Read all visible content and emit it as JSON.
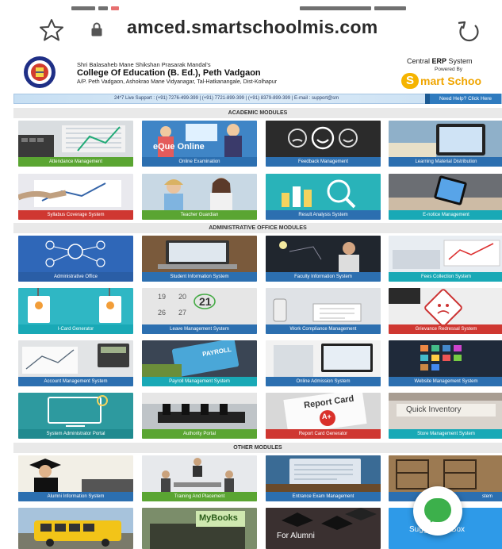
{
  "browser": {
    "url": "amced.smartschoolmis.com"
  },
  "header": {
    "trust": "Shri Balasaheb Mane Shikshan Prasarak Mandal's",
    "college": "College Of Education (B. Ed.), Peth Vadgaon",
    "address": "A/P. Peth Vadgaon, Ashokrao Mane Vidyanagar, Tal-Hatkanangale, Dist-Kolhapur",
    "erp_prefix": "Central ",
    "erp_bold": "ERP",
    "erp_suffix": " System",
    "powered_by": "Powered By",
    "brand_initial": "S",
    "brand_text": "mart Schoo"
  },
  "support": {
    "text": "24*7 Live Support : (+91) 7276-499-399 | (+91) 7721-899-399 | (+91) 8379-899-399 | E-mail : support@sm",
    "help_label": "Need Help? Click Here"
  },
  "sections": {
    "academic": "ACADEMIC MODULES",
    "administrative": "ADMINISTRATIVE OFFICE MODULES",
    "other": "OTHER MODULES"
  },
  "tiles": {
    "attendance": "Attendance Management",
    "online_exam": "Online Examination",
    "online_exam_art": "eQue Online",
    "feedback": "Feedback Management",
    "learning": "Learning Material Distribution",
    "syllabus": "Syllabus Coverage System",
    "teacher_guardian": "Teacher Guardian",
    "result": "Result Analysis System",
    "enotice": "E-notice Management",
    "admin_office": "Administrative Office",
    "student_info": "Student Information System",
    "faculty_info": "Faculty Information System",
    "fees": "Fees Collection System",
    "icard": "I-Card Generator",
    "leave": "Leave Management System",
    "work_compliance": "Work Compliance Management",
    "grievance": "Grievance Redressal System",
    "account": "Account Management System",
    "payroll": "Payroll Management System",
    "payroll_art": "PAYROLL",
    "online_admission": "Online Admission System",
    "website": "Website Management System",
    "sysadmin": "System Administrator Portal",
    "authority": "Authority Portal",
    "report_card": "Report Card Generator",
    "report_card_art": "Report Card",
    "report_card_grade": "A+",
    "store": "Store Management System",
    "store_art": "Quick Inventory",
    "alumni_info": "Alumni Information System",
    "training": "Training And Placement",
    "entrance": "Entrance Exam Management",
    "hostel": "stem",
    "mybooks_art": "MyBooks",
    "for_alumni_art": "For Alumni",
    "suggestion_art": "Suggestion Box"
  },
  "colors": {
    "bar_green": "#5aa532",
    "bar_blue": "#2c6fb0",
    "bar_red": "#cf3731",
    "bar_teal": "#19a9b6",
    "brand_orange": "#f0a500",
    "whatsapp_green": "#3cb04b"
  }
}
